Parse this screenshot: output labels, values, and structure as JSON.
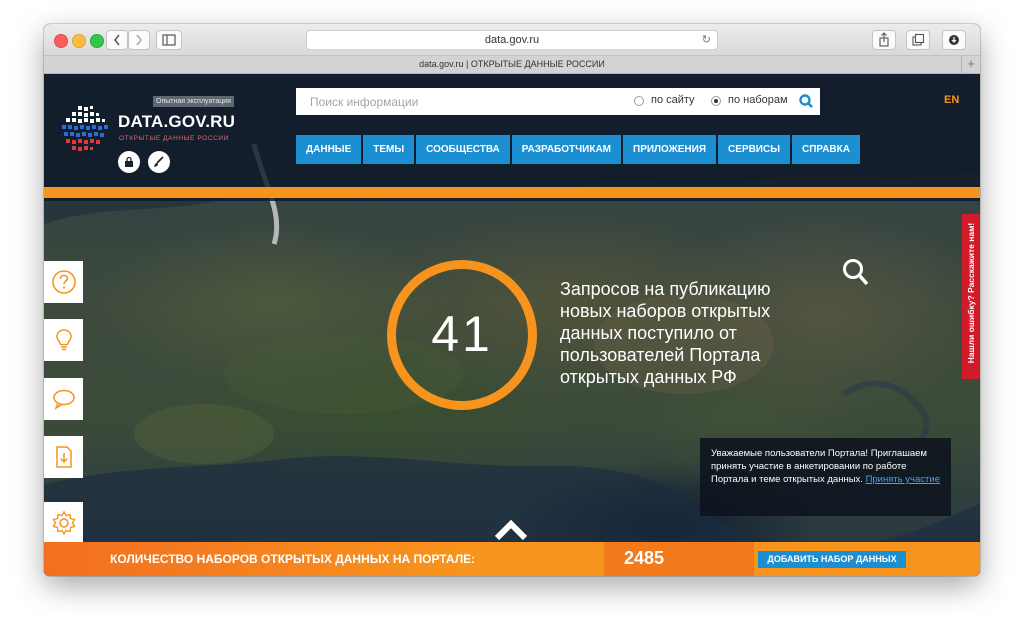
{
  "browser": {
    "url": "data.gov.ru",
    "tab_title": "data.gov.ru | ОТКРЫТЫЕ ДАННЫЕ РОССИИ",
    "reload_icon": "reload-icon",
    "new_tab": "+"
  },
  "header": {
    "beta_badge": "Опытная эксплуатация",
    "logo_title": "DATA.GOV.RU",
    "logo_subtitle": "ОТКРЫТЫЕ ДАННЫЕ РОССИИ",
    "lock_icon": "lock-icon",
    "brush_icon": "brush-icon",
    "lang": "EN"
  },
  "search": {
    "placeholder": "Поиск информации",
    "option_site": "по сайту",
    "option_datasets": "по наборам",
    "selected": "по наборам"
  },
  "nav": {
    "items": [
      {
        "label": "ДАННЫЕ"
      },
      {
        "label": "ТЕМЫ"
      },
      {
        "label": "СООБЩЕСТВА"
      },
      {
        "label": "РАЗРАБОТЧИКАМ"
      },
      {
        "label": "ПРИЛОЖЕНИЯ"
      },
      {
        "label": "СЕРВИСЫ"
      },
      {
        "label": "СПРАВКА"
      }
    ]
  },
  "sidebar": {
    "icons": [
      "question-icon",
      "lightbulb-icon",
      "comment-icon",
      "download-icon",
      "gear-icon"
    ]
  },
  "hero": {
    "number": "41",
    "text": "Запросов на публикацию новых наборов открытых данных поступило от пользователей  Портала открытых данных РФ"
  },
  "feedback": {
    "label": "Нашли ошибку? Расскажите нам!"
  },
  "survey": {
    "text": "Уважаемые пользователи Портала! Приглашаем принять участие в анкетировании по работе Портала и теме открытых данных.",
    "link": "Принять участие"
  },
  "bottom": {
    "label": "КОЛИЧЕСТВО НАБОРОВ ОТКРЫТЫХ ДАННЫХ НА ПОРТАЛЕ:",
    "count": "2485",
    "add_button": "ДОБАВИТЬ НАБОР ДАННЫХ"
  },
  "colors": {
    "accent_orange": "#f7941d",
    "nav_blue": "#1b8fd1",
    "feedback_red": "#d11a2a"
  }
}
